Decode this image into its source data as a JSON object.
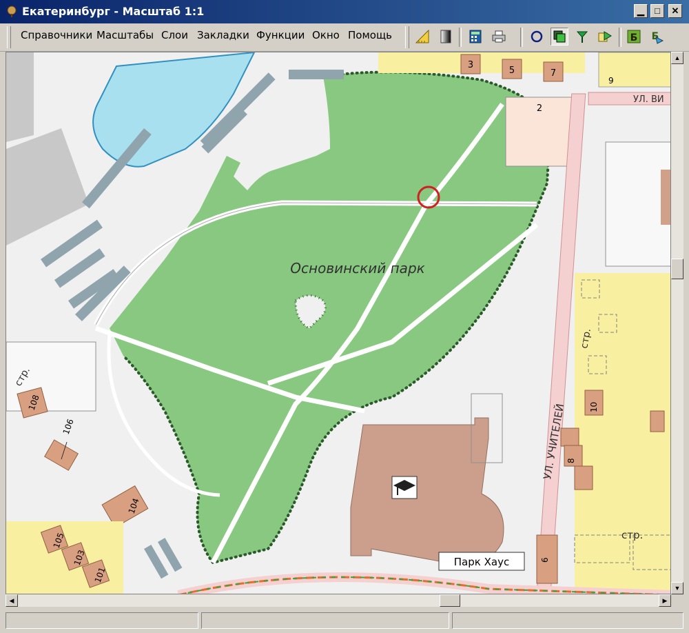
{
  "window": {
    "title": "Екатеринбург - Масштаб 1:1"
  },
  "menu": {
    "items": [
      "Справочники",
      "Масштабы",
      "Слои",
      "Закладки",
      "Функции",
      "Окно",
      "Помощь"
    ]
  },
  "toolbar": {
    "icons": [
      "ruler-icon",
      "gradient-icon",
      "calculator-icon",
      "printer-icon",
      "circle-icon",
      "layers-icon",
      "pin-icon",
      "route-icon",
      "b-icon",
      "b-arrow-icon"
    ]
  },
  "map": {
    "park_name": "Основинский парк",
    "street_teachers": "УЛ. УЧИТЕЛЕЙ",
    "street_top": "УЛ. ВИ",
    "poi_label": "Парк Хаус",
    "construction_label": "стр.",
    "buildings": {
      "b3": "3",
      "b5": "5",
      "b7": "7",
      "b9": "9",
      "b2": "2",
      "b108": "108",
      "b106": "106",
      "b104": "104",
      "b105": "105",
      "b103": "103",
      "b101": "101",
      "b10": "10",
      "b8": "8",
      "b6": "6"
    },
    "colors": {
      "park": "#88c880",
      "water": "#a8e0f0",
      "residential": "#f8f0a0",
      "building": "#d0a088"
    }
  }
}
